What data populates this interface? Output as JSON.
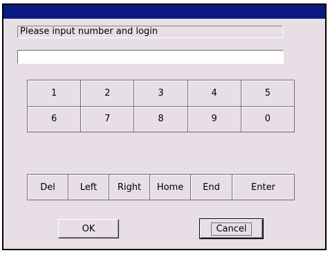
{
  "window": {
    "title": ""
  },
  "login": {
    "prompt": "Please input number and login",
    "input_value": "",
    "input_placeholder": ""
  },
  "keypad": {
    "keys": [
      "1",
      "2",
      "3",
      "4",
      "5",
      "6",
      "7",
      "8",
      "9",
      "0"
    ]
  },
  "edit_keys": {
    "del": "Del",
    "left": "Left",
    "right": "Right",
    "home": "Home",
    "end": "End",
    "enter": "Enter"
  },
  "actions": {
    "ok": "OK",
    "cancel": "Cancel"
  },
  "colors": {
    "titlebar": "#0a1a82",
    "dialog_background": "#e7dfe5",
    "input_background": "#ffffff"
  }
}
